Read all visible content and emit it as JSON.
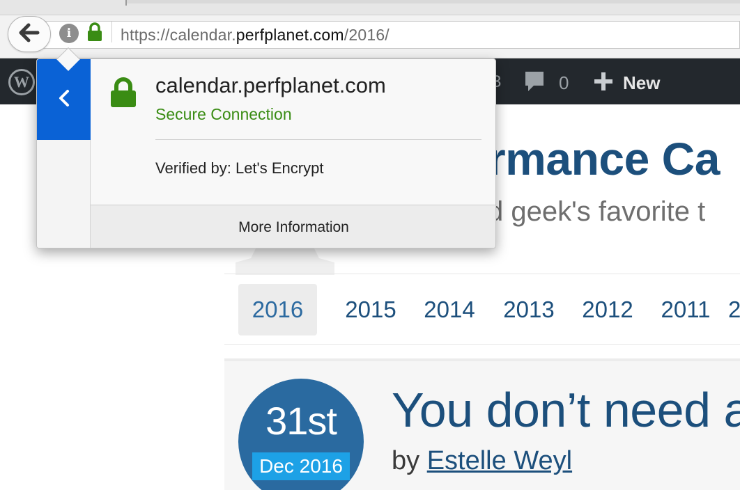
{
  "browser": {
    "url_prefix": "https://calendar.",
    "url_host": "perfplanet.com",
    "url_suffix": "/2016/",
    "back_icon": "arrow-left-icon",
    "info_icon_glyph": "i",
    "lock_color": "#3a8c14"
  },
  "admin_bar": {
    "partial_text": "3",
    "comments_count": "0",
    "new_label": "New"
  },
  "site": {
    "title_fragment": "rmance Ca",
    "tagline_fragment": "d geek's favorite t"
  },
  "year_nav": {
    "active": "2016",
    "years": [
      "2016",
      "2015",
      "2014",
      "2013",
      "2012",
      "2011",
      "2"
    ]
  },
  "article": {
    "day": "31st",
    "month": "Dec 2016",
    "title_fragment": "You don’t need a",
    "by_label": "by",
    "author": "Estelle Weyl"
  },
  "identity_popup": {
    "host": "calendar.perfplanet.com",
    "status": "Secure Connection",
    "verified_by": "Verified by: Let's Encrypt",
    "more_info_label": "More Information",
    "accent_color": "#0a62d6"
  }
}
